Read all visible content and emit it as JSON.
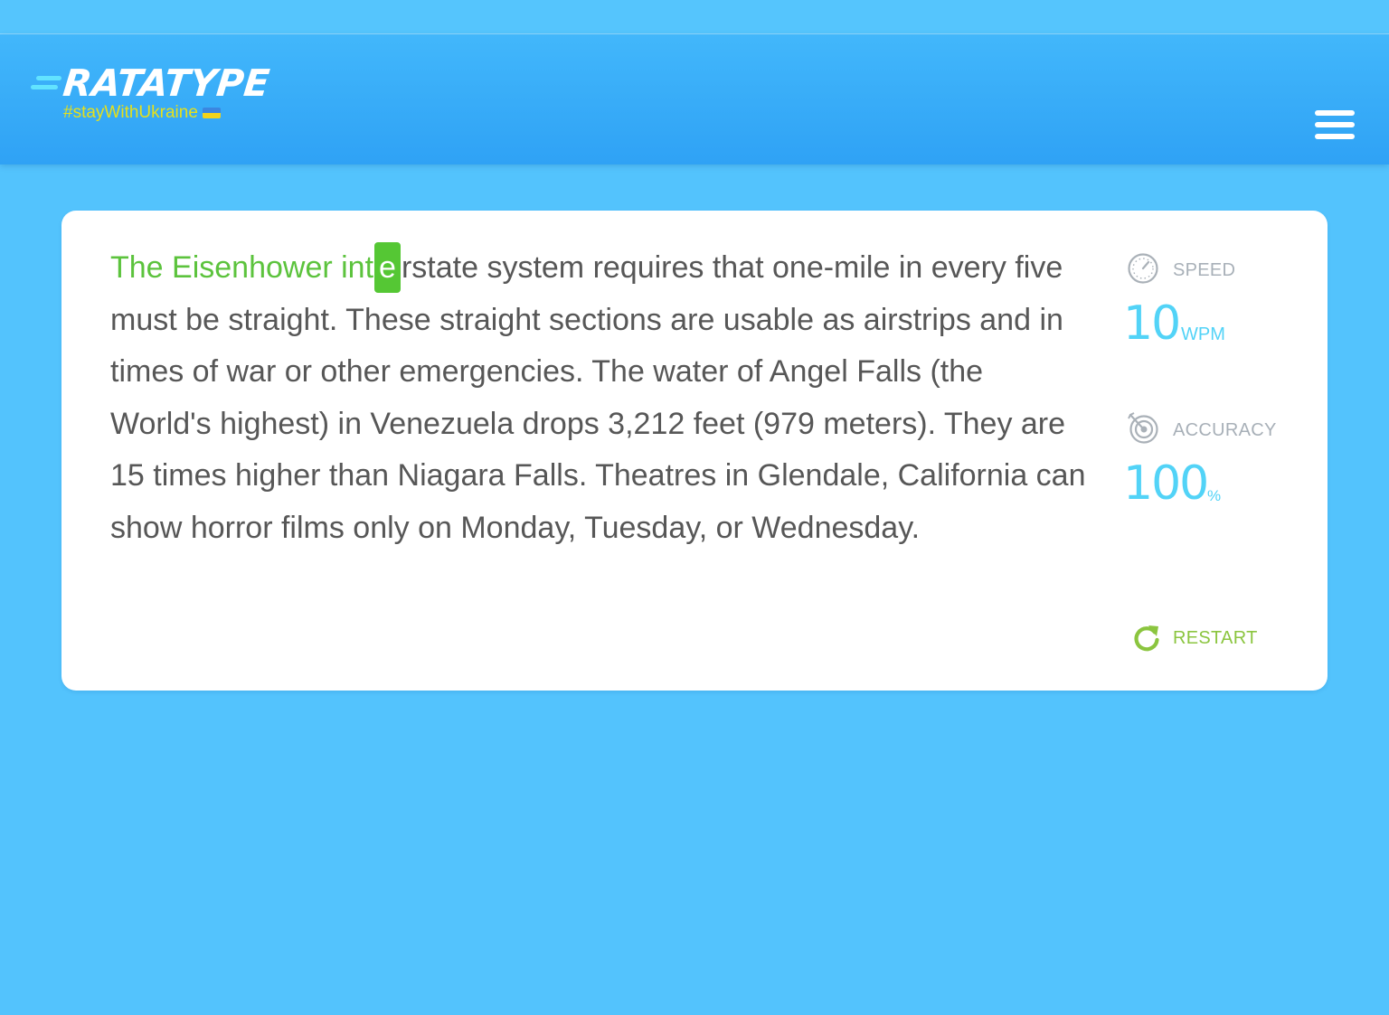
{
  "header": {
    "logo_text": "RATATYPE",
    "tagline": "#stayWithUkraine",
    "logo_accent_color": "#62e3ff",
    "tagline_color": "#e6e01a",
    "menu_icon": "hamburger-menu-icon"
  },
  "typing": {
    "typed_text": "The Eisenhower int",
    "current_char": "e",
    "remaining_text": "rstate system requires that one-mile in every five must be straight. These straight sections are usable as airstrips and in times of war or other emergencies. The water of Angel Falls (the World's highest) in Venezuela drops 3,212 feet (979 meters). They are 15 times higher than Niagara Falls. Theatres in Glendale, California can show horror films only on Monday, Tuesday, or Wednesday.",
    "typed_color": "#5cc33d",
    "cursor_color": "#55c734",
    "text_color": "#575757"
  },
  "stats": {
    "speed": {
      "label": "SPEED",
      "value": "10",
      "unit": "WPM",
      "icon": "speedometer-icon"
    },
    "accuracy": {
      "label": "ACCURACY",
      "value": "100",
      "unit": "%",
      "icon": "target-icon"
    },
    "value_color": "#52d3f7",
    "label_color": "#a8b0b8"
  },
  "restart": {
    "label": "RESTART",
    "icon": "restart-icon",
    "color": "#8bc53f"
  },
  "colors": {
    "background": "#53c3fd",
    "header": "#2fa2f5",
    "card": "#ffffff"
  }
}
